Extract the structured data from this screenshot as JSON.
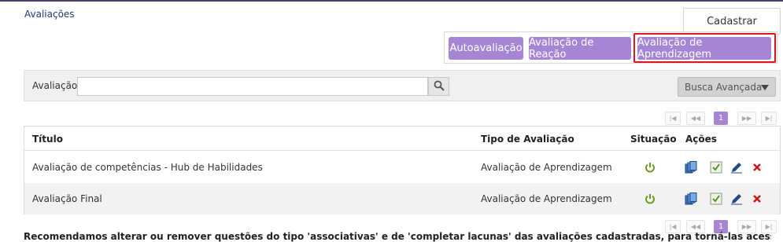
{
  "header": {
    "title": "Avaliações"
  },
  "actions": {
    "cadastrar_label": "Cadastrar"
  },
  "eval_types": [
    {
      "label": "Autoavaliação"
    },
    {
      "label": "Avaliação de Reação"
    },
    {
      "label": "Avaliação de Aprendizagem",
      "selected": true
    }
  ],
  "search": {
    "label": "Avaliação",
    "value": "",
    "placeholder": "",
    "advanced_label": "Busca Avançada"
  },
  "pagination": {
    "current_page": "1"
  },
  "table": {
    "columns": [
      "Título",
      "Tipo de Avaliação",
      "Situação",
      "Ações"
    ],
    "rows": [
      {
        "titulo": "Avaliação de competências - Hub de Habilidades",
        "tipo": "Avaliação de Aprendizagem"
      },
      {
        "titulo": "Avaliação Final",
        "tipo": "Avaliação de Aprendizagem"
      }
    ]
  },
  "footer": {
    "note": "Recomendamos alterar ou remover questões do tipo 'associativas' e de 'completar lacunas' das avaliações cadastradas, para torná-las acessíveis a usuários"
  },
  "colors": {
    "accent": "#a685d4",
    "selected_outline": "#e3121b",
    "header_bar": "#4b3a6b",
    "active_icon": "#6c9a1e",
    "delete_icon": "#cc1a1a"
  },
  "icons": {
    "search": "search-icon",
    "status": "power-icon",
    "copy": "copy-icon",
    "questions": "checklist-icon",
    "edit": "pencil-icon",
    "delete": "delete-icon"
  }
}
